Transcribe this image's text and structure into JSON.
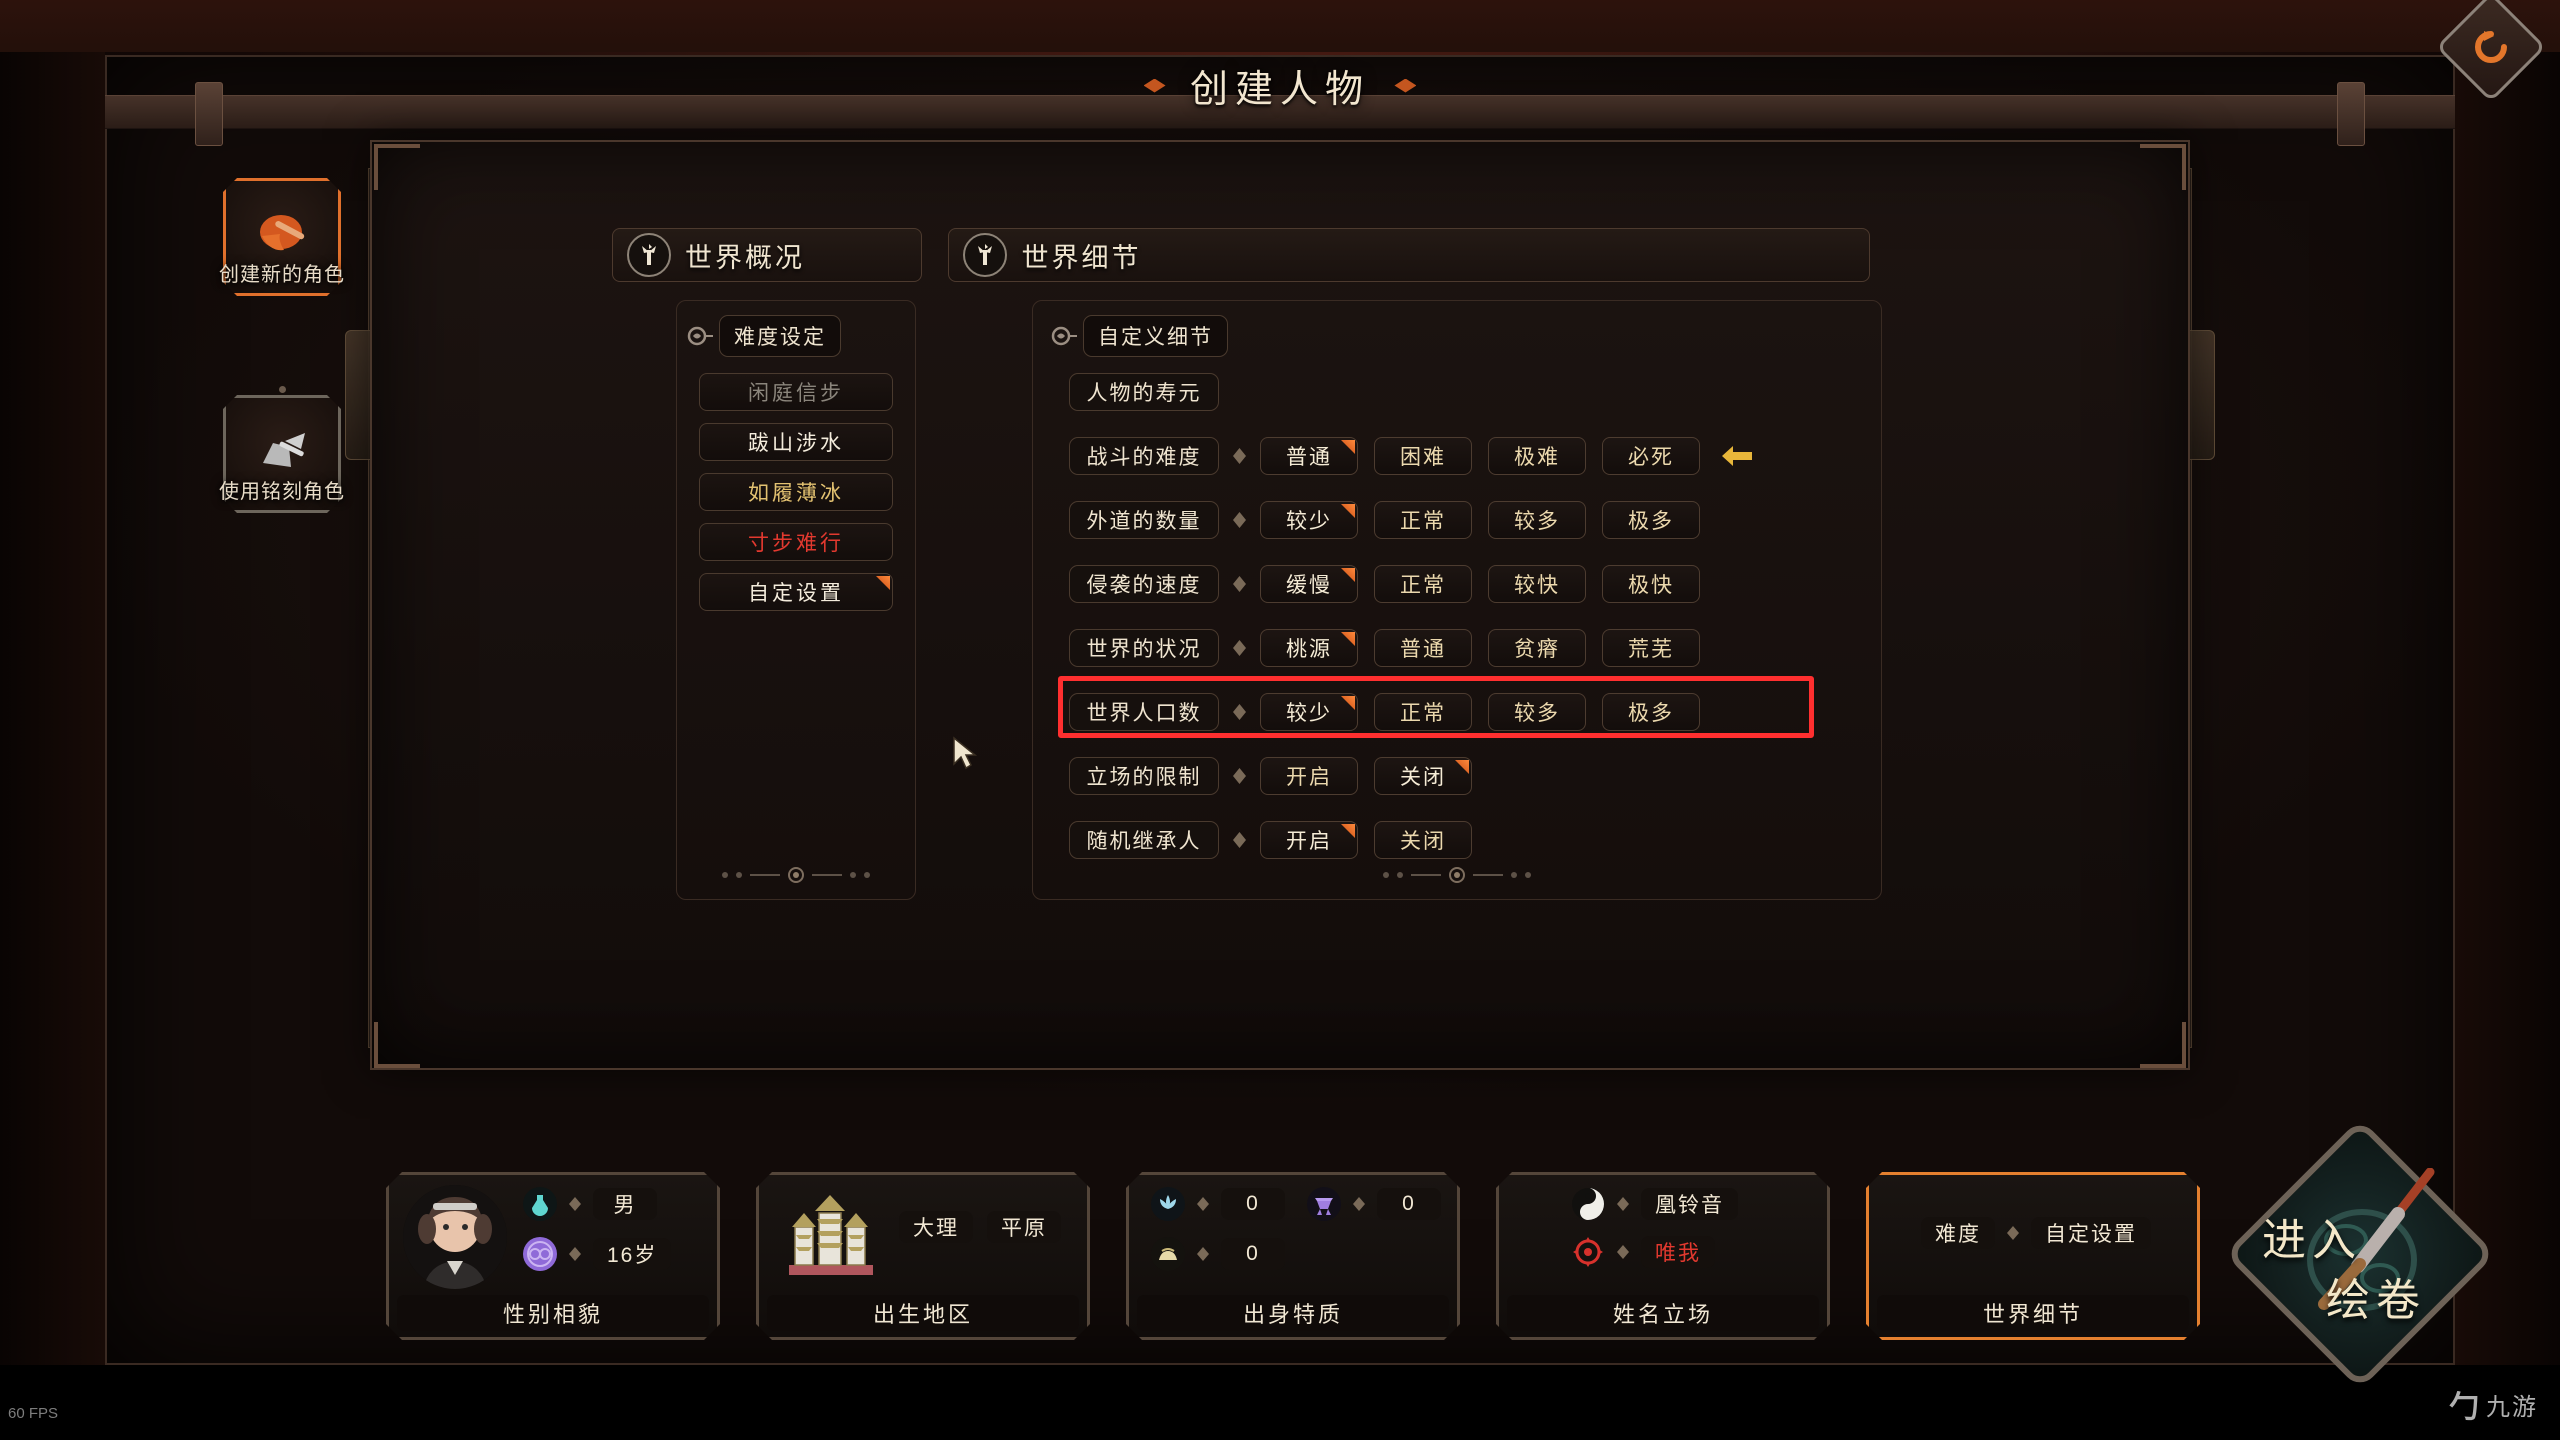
{
  "window": {
    "title": "创建人物",
    "reroll_icon": "refresh-icon",
    "fps": "60 FPS",
    "watermark_glyph": "勹",
    "watermark_text": "九游"
  },
  "sidebar": {
    "items": [
      {
        "label": "创建新的角色",
        "icon": "brush-helmet-icon",
        "active": true
      },
      {
        "label": "使用铭刻角色",
        "icon": "engraved-stone-icon",
        "active": false
      }
    ]
  },
  "tabs": [
    {
      "label": "世界概况",
      "icon": "tree-icon",
      "active": false
    },
    {
      "label": "世界细节",
      "icon": "tree-icon",
      "active": true
    }
  ],
  "difficulty_panel": {
    "icon": "scroll-tag-icon",
    "header": "难度设定",
    "options": [
      {
        "label": "闲庭信步",
        "color_class": "c-gray",
        "selected": false
      },
      {
        "label": "跋山涉水",
        "color_class": "c-white",
        "selected": false
      },
      {
        "label": "如履薄冰",
        "color_class": "c-gold",
        "selected": false
      },
      {
        "label": "寸步难行",
        "color_class": "c-red",
        "selected": false
      },
      {
        "label": "自定设置",
        "color_class": "c-white",
        "selected": true
      }
    ]
  },
  "detail_panel": {
    "icon": "scroll-tag-icon",
    "header": "自定义细节",
    "lifespan_row": {
      "label": "人物的寿元"
    },
    "rows": [
      {
        "label": "战斗的难度",
        "options": [
          "普通",
          "困难",
          "极难",
          "必死"
        ],
        "selected": 0,
        "has_arrow": true,
        "highlight": false
      },
      {
        "label": "外道的数量",
        "options": [
          "较少",
          "正常",
          "较多",
          "极多"
        ],
        "selected": 0,
        "has_arrow": false,
        "highlight": false
      },
      {
        "label": "侵袭的速度",
        "options": [
          "缓慢",
          "正常",
          "较快",
          "极快"
        ],
        "selected": 0,
        "has_arrow": false,
        "highlight": false
      },
      {
        "label": "世界的状况",
        "options": [
          "桃源",
          "普通",
          "贫瘠",
          "荒芜"
        ],
        "selected": 0,
        "has_arrow": false,
        "highlight": false
      },
      {
        "label": "世界人口数",
        "options": [
          "较少",
          "正常",
          "较多",
          "极多"
        ],
        "selected": 0,
        "has_arrow": false,
        "highlight": true
      },
      {
        "label": "立场的限制",
        "options": [
          "开启",
          "关闭"
        ],
        "selected": 1,
        "has_arrow": false,
        "highlight": false
      },
      {
        "label": "随机继承人",
        "options": [
          "开启",
          "关闭"
        ],
        "selected": 0,
        "has_arrow": false,
        "highlight": false
      }
    ]
  },
  "bottom_cards": [
    {
      "title": "性别相貌",
      "active": false,
      "has_portrait": true,
      "stats": [
        {
          "icon": "potion-icon",
          "icon_color": "#5fd6d0",
          "value": "男"
        },
        {
          "icon": "soul-orb-icon",
          "icon_color": "#8f6ad8",
          "value": "16岁"
        }
      ]
    },
    {
      "title": "出生地区",
      "active": false,
      "has_portrait": false,
      "region_icon": "pagoda-icon",
      "region_values": [
        "大理",
        "平原"
      ]
    },
    {
      "title": "出身特质",
      "active": false,
      "has_portrait": false,
      "stats": [
        {
          "icon": "lotus-icon",
          "icon_color": "#9fd8ea",
          "value": "0"
        },
        {
          "icon": "bell-icon",
          "icon_color": "#9f7ee0",
          "value": "0"
        },
        {
          "icon": "ingot-icon",
          "icon_color": "#e6d9a8",
          "value": "0"
        }
      ]
    },
    {
      "title": "姓名立场",
      "active": false,
      "has_portrait": false,
      "stats": [
        {
          "icon": "yinyang-icon",
          "icon_color": "#f0efe9",
          "value": "凰铃音",
          "value_color": "#f2e8d4"
        },
        {
          "icon": "target-icon",
          "icon_color": "#d8312c",
          "value": "唯我",
          "value_color": "#e3392f"
        }
      ]
    },
    {
      "title": "世界细节",
      "active": true,
      "has_portrait": false,
      "stats": [
        {
          "icon": "none",
          "value": "难度",
          "value2": "自定设置"
        }
      ]
    }
  ],
  "enter_button": {
    "line1": "进入",
    "line2": "绘卷",
    "icon": "brush-scroll-icon"
  },
  "colors": {
    "accent_orange": "#e4802f",
    "highlight_red": "#ff2f2f",
    "gold": "#e3c271",
    "danger_red": "#e3392f",
    "parchment": "#f0e5d0"
  }
}
